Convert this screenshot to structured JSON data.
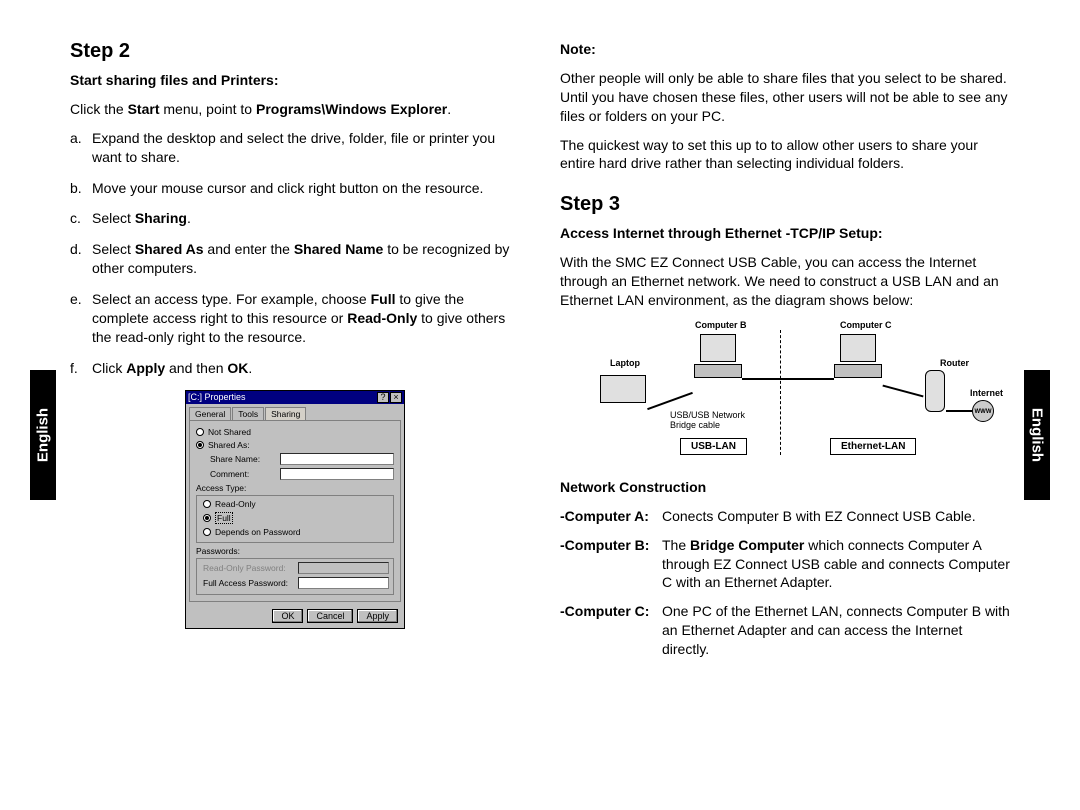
{
  "sidebar_label": "English",
  "left": {
    "step_title": "Step 2",
    "sub": "Start sharing files and Printers:",
    "intro": {
      "p1": "Click the ",
      "b1": "Start",
      "p2": " menu, point to ",
      "b2": "Programs\\Windows Explorer",
      "p3": "."
    },
    "items": [
      {
        "m": "a.",
        "text": "Expand the desktop and select the drive, folder, file or printer you want to share."
      },
      {
        "m": "b.",
        "text": "Move your mouse cursor and click right button on the resource."
      },
      {
        "m": "c.",
        "pre": "Select ",
        "b": "Sharing",
        "post": "."
      },
      {
        "m": "d.",
        "pre": "Select ",
        "b1": "Shared As",
        "mid": " and enter the ",
        "b2": "Shared Name",
        "post": " to be recognized by other computers."
      },
      {
        "m": "e.",
        "pre": "Select an access type. For example, choose ",
        "b1": "Full",
        "mid": " to give the complete access right to this resource or ",
        "b2": "Read-Only",
        "post": " to give others the read-only right to the resource."
      },
      {
        "m": "f.",
        "pre": "Click ",
        "b1": "Apply",
        "mid": " and then ",
        "b2": "OK",
        "post": "."
      }
    ],
    "dialog": {
      "title": "[C:] Properties",
      "tabs": [
        "General",
        "Tools",
        "Sharing"
      ],
      "not_shared": "Not Shared",
      "shared_as": "Shared As:",
      "share_name": "Share Name:",
      "comment": "Comment:",
      "access_type": "Access Type:",
      "read_only": "Read-Only",
      "full": "Full",
      "depends": "Depends on Password",
      "passwords": "Passwords:",
      "ro_pw": "Read-Only Password:",
      "full_pw": "Full Access Password:",
      "ok": "OK",
      "cancel": "Cancel",
      "apply": "Apply"
    }
  },
  "right": {
    "note_h": "Note:",
    "note_p1": "Other people will only be able to share files that you select to be shared.  Until you have chosen these files, other users will not be able to see any files or folders on your PC.",
    "note_p2": "The quickest way to set this up to to allow other users to share your entire hard drive rather than selecting individual folders.",
    "step_title": "Step 3",
    "sub": "Access Internet through Ethernet -TCP/IP Setup:",
    "intro": "With the SMC EZ Connect USB Cable, you can access the Internet through an Ethernet network. We need to construct a USB LAN and an Ethernet LAN environment, as the diagram shows below:",
    "diagram": {
      "compB": "Computer B",
      "compC": "Computer C",
      "laptop": "Laptop",
      "router": "Router",
      "internet": "Internet",
      "bridge": "USB/USB Network Bridge cable",
      "usb_lan": "USB-LAN",
      "eth_lan": "Ethernet-LAN"
    },
    "nc": "Network Construction",
    "defs": [
      {
        "term": "-Computer A:",
        "text": "Conects Computer B with EZ Connect USB Cable."
      },
      {
        "term": "-Computer B:",
        "pre": "The ",
        "b": "Bridge Computer",
        "post": " which connects Computer A through EZ Connect USB cable and connects Computer C  with an Ethernet Adapter."
      },
      {
        "term": "-Computer C:",
        "text": "One PC of the Ethernet LAN, connects Computer B with an Ethernet Adapter and can access the Internet directly."
      }
    ]
  }
}
